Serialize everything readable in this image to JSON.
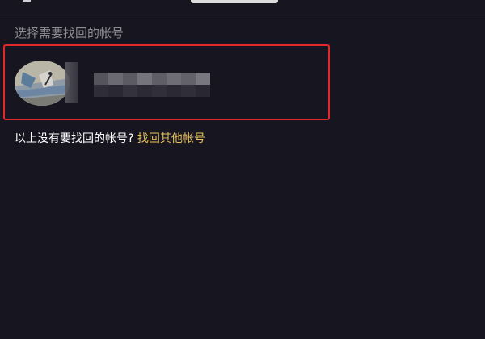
{
  "section": {
    "label": "选择需要找回的帐号"
  },
  "account": {
    "name_hidden": true
  },
  "footer": {
    "question": "以上没有要找回的帐号?",
    "link": "找回其他帐号"
  },
  "colors": {
    "background": "#171620",
    "highlight_border": "#e02a2a",
    "link": "#e8c25c",
    "label": "#8d8c93"
  }
}
